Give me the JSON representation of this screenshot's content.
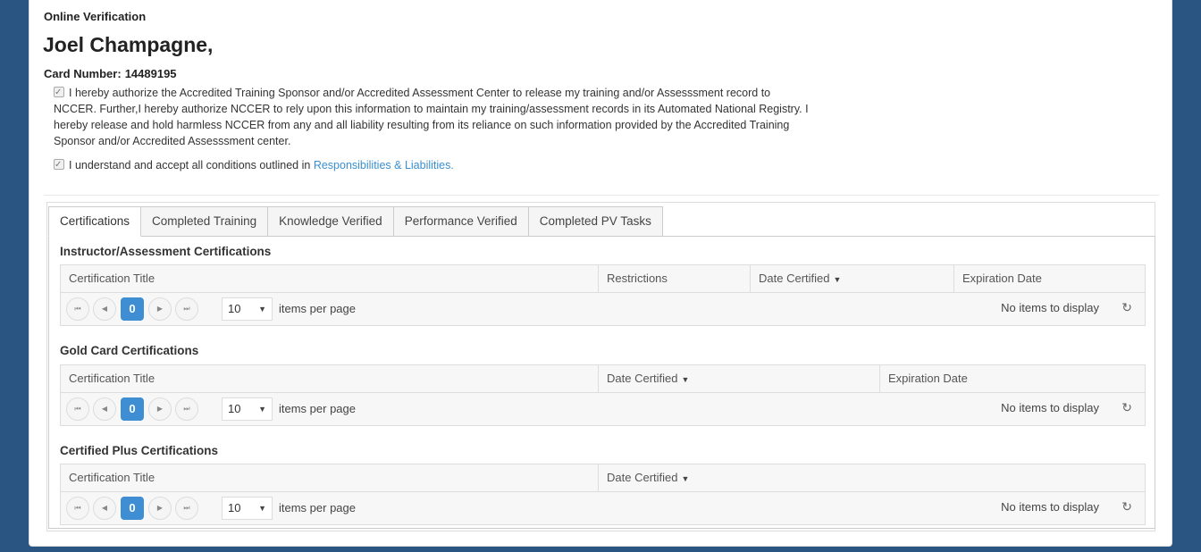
{
  "header": {
    "page_label": "Online Verification",
    "name": "Joel Champagne,",
    "card_number_label": "Card Number:",
    "card_number": "14489195"
  },
  "consent": {
    "authorize_text": "I hereby authorize the Accredited Training Sponsor and/or Accredited Assessment Center to release my training and/or Assesssment record to NCCER. Further,I hereby authorize NCCER to rely upon this information to maintain my training/assessment records in its Automated National Registry. I hereby release and hold harmless NCCER from any and all liability resulting from its reliance on such information provided by the Accredited Training Sponsor and/or Accredited Assesssment center.",
    "accept_text": "I understand and accept all conditions outlined in",
    "accept_link": "Responsibilities & Liabilities."
  },
  "tabs": [
    {
      "label": "Certifications"
    },
    {
      "label": "Completed Training"
    },
    {
      "label": "Knowledge Verified"
    },
    {
      "label": "Performance Verified"
    },
    {
      "label": "Completed PV Tasks"
    }
  ],
  "sections": [
    {
      "title": "Instructor/Assessment Certifications",
      "columns": [
        "Certification Title",
        "Restrictions",
        "Date Certified",
        "Expiration Date"
      ],
      "page": "0",
      "page_size": "10",
      "items_per_page": "items per page",
      "status": "No items to display"
    },
    {
      "title": "Gold Card Certifications",
      "columns": [
        "Certification Title",
        "Date Certified",
        "Expiration Date"
      ],
      "page": "0",
      "page_size": "10",
      "items_per_page": "items per page",
      "status": "No items to display"
    },
    {
      "title": "Certified Plus Certifications",
      "columns": [
        "Certification Title",
        "Date Certified"
      ],
      "page": "0",
      "page_size": "10",
      "items_per_page": "items per page",
      "status": "No items to display"
    }
  ],
  "pager_icons": [
    "first-page-icon",
    "prev-page-icon",
    "next-page-icon",
    "last-page-icon"
  ],
  "colors": {
    "background": "#2a5582",
    "accent": "#3f8ed3",
    "link": "#3a8fd0"
  }
}
